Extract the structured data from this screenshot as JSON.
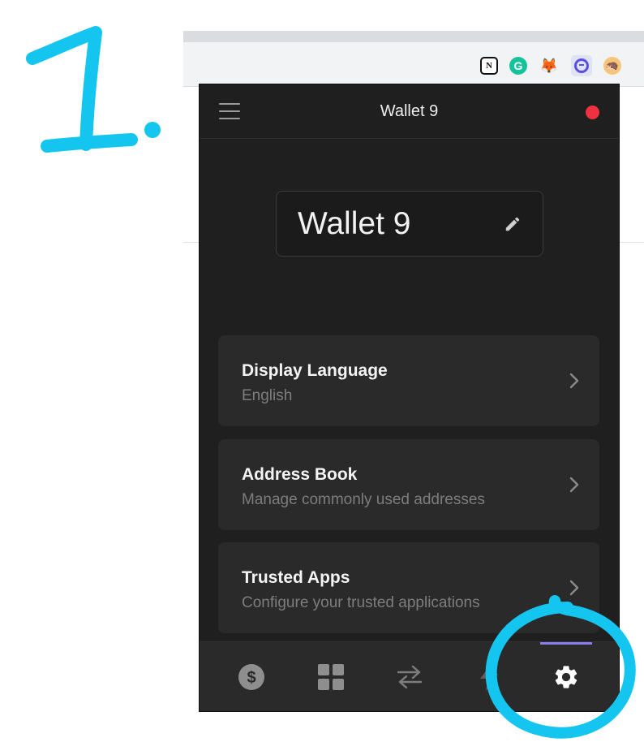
{
  "annotation": {
    "step_number": "1."
  },
  "browser": {
    "extensions": [
      {
        "name": "notion-icon",
        "glyph": "N"
      },
      {
        "name": "grammarly-icon",
        "glyph": "G"
      },
      {
        "name": "metamask-icon",
        "glyph": "🦊"
      },
      {
        "name": "wallet-extension-icon",
        "glyph": ""
      },
      {
        "name": "profile-avatar-icon",
        "glyph": "🦔"
      }
    ]
  },
  "wallet": {
    "header_title": "Wallet 9",
    "wallet_name": "Wallet 9",
    "status_color": "#f0313f",
    "accent_color": "#8a7df0"
  },
  "settings": [
    {
      "title": "Display Language",
      "subtitle": "English"
    },
    {
      "title": "Address Book",
      "subtitle": "Manage commonly used addresses"
    },
    {
      "title": "Trusted Apps",
      "subtitle": "Configure your trusted applications"
    }
  ],
  "bottom_nav": [
    {
      "icon": "dollar-icon",
      "active": false
    },
    {
      "icon": "grid-icon",
      "active": false
    },
    {
      "icon": "swap-icon",
      "active": false
    },
    {
      "icon": "lightning-icon",
      "active": false
    },
    {
      "icon": "gear-icon",
      "active": true
    }
  ]
}
